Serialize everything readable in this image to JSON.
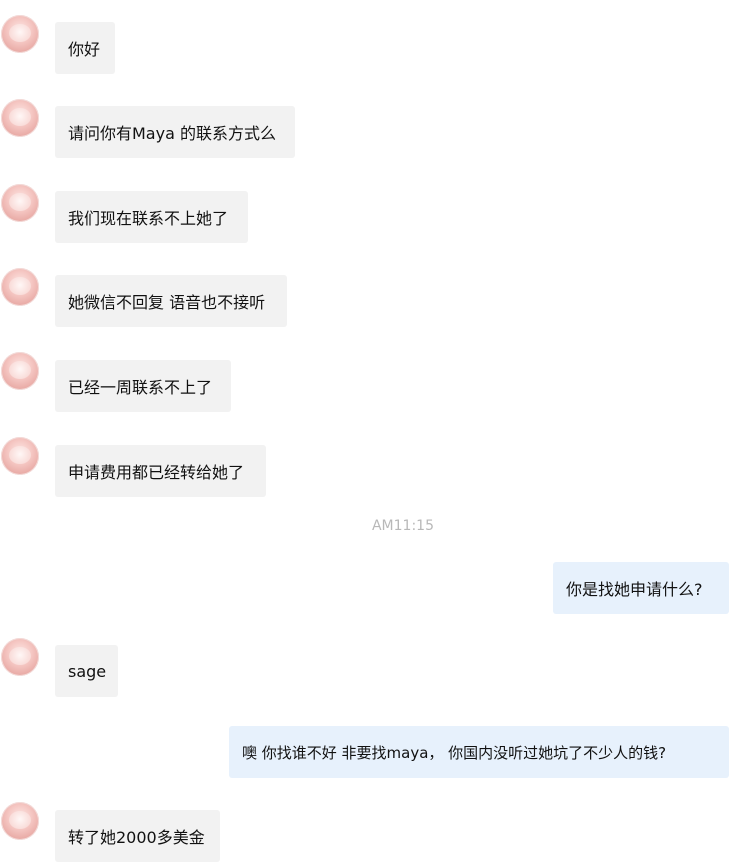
{
  "conversation": {
    "timestamp": "AM11:15",
    "messages": [
      {
        "side": "in",
        "text": "你好"
      },
      {
        "side": "in",
        "text": "请问你有Maya 的联系方式么"
      },
      {
        "side": "in",
        "text": "我们现在联系不上她了"
      },
      {
        "side": "in",
        "text": "她微信不回复 语音也不接听"
      },
      {
        "side": "in",
        "text": "已经一周联系不上了"
      },
      {
        "side": "in",
        "text": "申请费用都已经转给她了"
      },
      {
        "side": "out",
        "text": "你是找她申请什么?"
      },
      {
        "side": "in",
        "text": "sage"
      },
      {
        "side": "out",
        "text": "噢 你找谁不好 非要找maya， 你国内没听过她坑了不少人的钱?"
      },
      {
        "side": "in",
        "text": "转了她2000多美金"
      }
    ]
  },
  "colors": {
    "incoming_bubble": "#f2f2f2",
    "outgoing_bubble": "#e7f1fc",
    "timestamp_text": "#b8b8b8"
  },
  "icons": {
    "contact_avatar": "pink-blurred-avatar-icon"
  }
}
